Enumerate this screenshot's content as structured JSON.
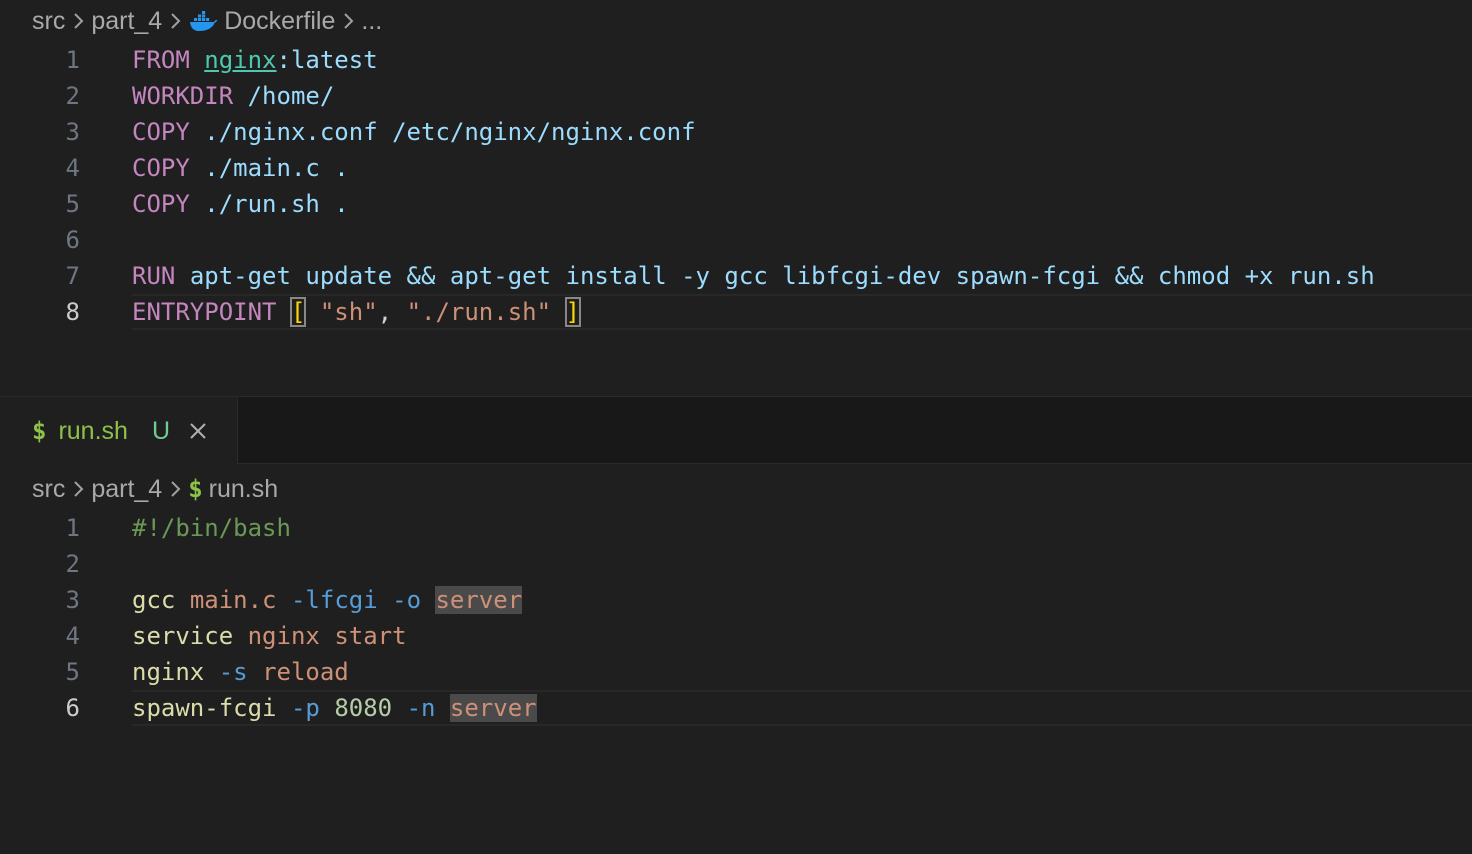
{
  "top_editor": {
    "breadcrumb": [
      "src",
      "part_4",
      "Dockerfile",
      "..."
    ],
    "breadcrumb_file_icon": "docker-icon",
    "active_line": 8,
    "lines": [
      {
        "n": "1",
        "tokens": [
          [
            "kw",
            "FROM"
          ],
          [
            "plain",
            " "
          ],
          [
            "link",
            "nginx"
          ],
          [
            "str",
            ":latest"
          ]
        ]
      },
      {
        "n": "2",
        "tokens": [
          [
            "kw",
            "WORKDIR"
          ],
          [
            "plain",
            " "
          ],
          [
            "str",
            "/home/"
          ]
        ]
      },
      {
        "n": "3",
        "tokens": [
          [
            "kw",
            "COPY"
          ],
          [
            "plain",
            " "
          ],
          [
            "str",
            "./nginx.conf /etc/nginx/nginx.conf"
          ]
        ]
      },
      {
        "n": "4",
        "tokens": [
          [
            "kw",
            "COPY"
          ],
          [
            "plain",
            " "
          ],
          [
            "str",
            "./main.c ."
          ]
        ]
      },
      {
        "n": "5",
        "tokens": [
          [
            "kw",
            "COPY"
          ],
          [
            "plain",
            " "
          ],
          [
            "str",
            "./run.sh ."
          ]
        ]
      },
      {
        "n": "6",
        "tokens": []
      },
      {
        "n": "7",
        "tokens": [
          [
            "kw",
            "RUN"
          ],
          [
            "plain",
            " "
          ],
          [
            "str",
            "apt-get update && apt-get install -y gcc libfcgi-dev spawn-fcgi && chmod +x run.sh"
          ]
        ]
      },
      {
        "n": "8",
        "tokens": [
          [
            "kw",
            "ENTRYPOINT"
          ],
          [
            "plain",
            " "
          ],
          [
            "brk",
            "["
          ],
          [
            "plain",
            " "
          ],
          [
            "dstr",
            "\"sh\""
          ],
          [
            "plain",
            ", "
          ],
          [
            "dstr",
            "\"./run.sh\""
          ],
          [
            "plain",
            " "
          ],
          [
            "brk",
            "]"
          ]
        ]
      }
    ]
  },
  "bottom_tab": {
    "icon": "$",
    "name": "run.sh",
    "status": "U",
    "close_icon": "close-icon"
  },
  "bottom_editor": {
    "breadcrumb": [
      "src",
      "part_4",
      "run.sh"
    ],
    "breadcrumb_file_icon": "$",
    "active_line": 6,
    "lines": [
      {
        "n": "1",
        "tokens": [
          [
            "comment",
            "#!/bin/bash"
          ]
        ]
      },
      {
        "n": "2",
        "tokens": []
      },
      {
        "n": "3",
        "tokens": [
          [
            "fn",
            "gcc"
          ],
          [
            "plain",
            " "
          ],
          [
            "arg",
            "main.c"
          ],
          [
            "plain",
            " "
          ],
          [
            "flag",
            "-lfcgi"
          ],
          [
            "plain",
            " "
          ],
          [
            "flag",
            "-o"
          ],
          [
            "plain",
            " "
          ],
          [
            "arg hl",
            "server"
          ]
        ]
      },
      {
        "n": "4",
        "tokens": [
          [
            "fn",
            "service"
          ],
          [
            "plain",
            " "
          ],
          [
            "arg",
            "nginx"
          ],
          [
            "plain",
            " "
          ],
          [
            "arg",
            "start"
          ]
        ]
      },
      {
        "n": "5",
        "tokens": [
          [
            "fn",
            "nginx"
          ],
          [
            "plain",
            " "
          ],
          [
            "flag",
            "-s"
          ],
          [
            "plain",
            " "
          ],
          [
            "arg",
            "reload"
          ]
        ]
      },
      {
        "n": "6",
        "tokens": [
          [
            "fn",
            "spawn-fcgi"
          ],
          [
            "plain",
            " "
          ],
          [
            "flag",
            "-p"
          ],
          [
            "plain",
            " "
          ],
          [
            "num",
            "8080"
          ],
          [
            "plain",
            " "
          ],
          [
            "flag",
            "-n"
          ],
          [
            "plain",
            " "
          ],
          [
            "arg hl",
            "server"
          ]
        ]
      }
    ]
  },
  "colors": {
    "background": "#1f1f1f",
    "keyword": "#c586c0",
    "string": "#9cdcfe",
    "shell_command": "#dcdcaa",
    "shell_arg": "#ce9178",
    "shell_flag": "#569cd6",
    "comment": "#6a9955",
    "file_icon_shell": "#8dc149",
    "docker_blue": "#2496ed"
  }
}
